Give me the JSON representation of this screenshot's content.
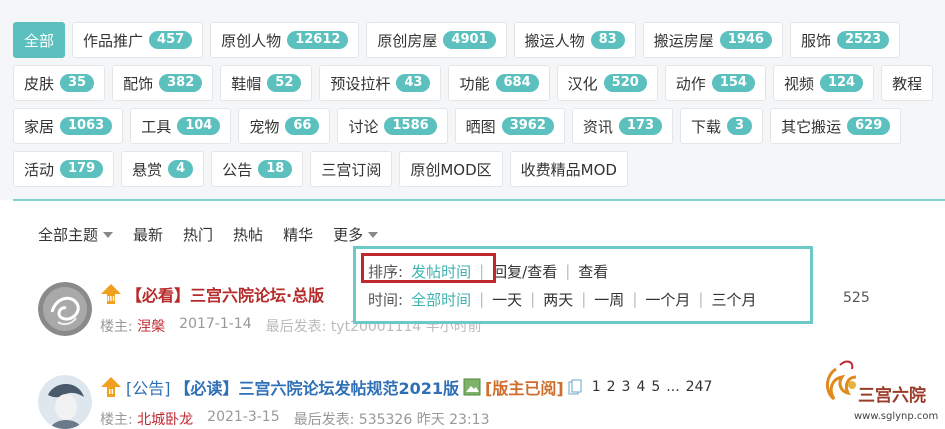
{
  "tags": {
    "row1": [
      {
        "label": "全部",
        "active": true
      },
      {
        "label": "作品推广",
        "count": "457"
      },
      {
        "label": "原创人物",
        "count": "12612"
      },
      {
        "label": "原创房屋",
        "count": "4901"
      },
      {
        "label": "搬运人物",
        "count": "83"
      },
      {
        "label": "搬运房屋",
        "count": "1946"
      },
      {
        "label": "服饰",
        "count": "2523"
      }
    ],
    "row2": [
      {
        "label": "皮肤",
        "count": "35"
      },
      {
        "label": "配饰",
        "count": "382"
      },
      {
        "label": "鞋帽",
        "count": "52"
      },
      {
        "label": "预设拉杆",
        "count": "43"
      },
      {
        "label": "功能",
        "count": "684"
      },
      {
        "label": "汉化",
        "count": "520"
      },
      {
        "label": "动作",
        "count": "154"
      },
      {
        "label": "视频",
        "count": "124"
      },
      {
        "label": "教程"
      }
    ],
    "row3": [
      {
        "label": "家居",
        "count": "1063"
      },
      {
        "label": "工具",
        "count": "104"
      },
      {
        "label": "宠物",
        "count": "66"
      },
      {
        "label": "讨论",
        "count": "1586"
      },
      {
        "label": "晒图",
        "count": "3962"
      },
      {
        "label": "资讯",
        "count": "173"
      },
      {
        "label": "下载",
        "count": "3"
      },
      {
        "label": "其它搬运",
        "count": "629"
      }
    ],
    "row4": [
      {
        "label": "活动",
        "count": "179"
      },
      {
        "label": "悬赏",
        "count": "4"
      },
      {
        "label": "公告",
        "count": "18"
      },
      {
        "label": "三宫订阅"
      },
      {
        "label": "原创MOD区"
      },
      {
        "label": "收费精品MOD"
      }
    ]
  },
  "nav": {
    "all_topics": "全部主题",
    "latest": "最新",
    "hot": "热门",
    "hot_posts": "热帖",
    "digest": "精华",
    "more": "更多"
  },
  "dropdown": {
    "sort_label": "排序:",
    "sort_options": [
      "发帖时间",
      "回复/查看",
      "查看"
    ],
    "time_label": "时间:",
    "time_options": [
      "全部时间",
      "一天",
      "两天",
      "一周",
      "一个月",
      "三个月"
    ]
  },
  "threads": [
    {
      "title": "【必看】三宫六院论坛·总版",
      "author_label": "楼主:",
      "author": "涅槃",
      "date": "2017-1-14",
      "last_post": "最后发表: tyt20001114   半小时前",
      "reply_count": "525"
    },
    {
      "type": "[公告]",
      "title": "【必读】三宫六院论坛发帖规范2021版",
      "badge": "[版主已阅]",
      "pages": [
        "1",
        "2",
        "3",
        "4",
        "5",
        "...",
        "247"
      ],
      "author_label": "楼主:",
      "author": "北城卧龙",
      "date": "2021-3-15",
      "last_post": "最后发表: 535326   昨天 23:13"
    }
  ],
  "watermark": {
    "name": "三宫六院",
    "url": "www.sglynp.com"
  },
  "colors": {
    "accent": "#5bc0be",
    "highlight_box": "#c0282f",
    "sticky_title": "#b72a2a"
  }
}
